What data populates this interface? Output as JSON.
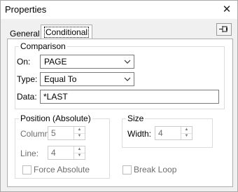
{
  "window": {
    "title": "Properties"
  },
  "icons": {
    "close": "close-icon",
    "pin": "pin-icon",
    "dropdown": "chevron-down-icon"
  },
  "tabs": [
    {
      "label": "General",
      "selected": false
    },
    {
      "label": "Conditional",
      "selected": true
    }
  ],
  "comparison": {
    "legend": "Comparison",
    "on_label": "On:",
    "on_value": "PAGE",
    "type_label": "Type:",
    "type_value": "Equal To",
    "data_label": "Data:",
    "data_value": "*LAST"
  },
  "position": {
    "legend": "Position (Absolute)",
    "column_label": "Column:",
    "column_value": "5",
    "line_label": "Line:",
    "line_value": "4",
    "force_absolute_label": "Force Absolute",
    "force_absolute_checked": false
  },
  "size": {
    "legend": "Size",
    "width_label": "Width:",
    "width_value": "4",
    "break_loop_label": "Break Loop",
    "break_loop_checked": false
  },
  "colors": {
    "border": "#adadad",
    "disabled_text": "#6d6d6d",
    "window_bg": "#f0f0f0"
  }
}
